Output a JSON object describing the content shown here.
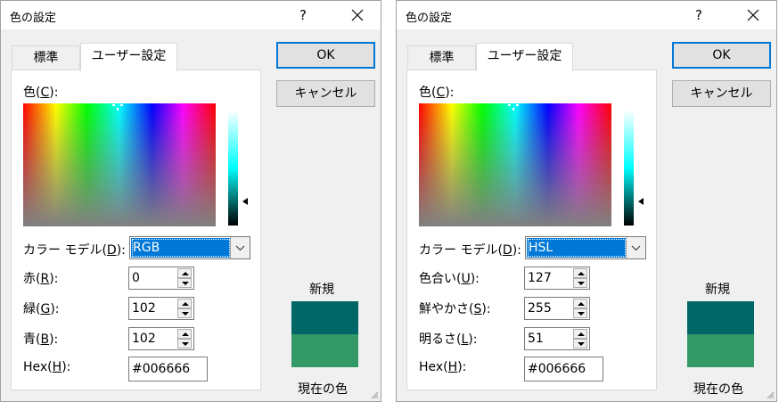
{
  "dialogs": [
    {
      "title": "色の設定",
      "help": "?",
      "tabs": [
        "標準",
        "ユーザー設定"
      ],
      "color_label_prefix": "色(",
      "color_label_key": "C",
      "color_label_suffix": "):",
      "model_label_prefix": "カラー モデル(",
      "model_label_key": "D",
      "model_label_suffix": "):",
      "model_value": "RGB",
      "fields": [
        {
          "prefix": "赤(",
          "key": "R",
          "suffix": "):",
          "value": "0"
        },
        {
          "prefix": "緑(",
          "key": "G",
          "suffix": "):",
          "value": "102"
        },
        {
          "prefix": "青(",
          "key": "B",
          "suffix": "):",
          "value": "102"
        }
      ],
      "hex_prefix": "Hex(",
      "hex_key": "H",
      "hex_suffix": "):",
      "hex_value": "#006666",
      "ok_label": "OK",
      "cancel_label": "キャンセル",
      "new_label": "新規",
      "current_label": "現在の色"
    },
    {
      "title": "色の設定",
      "help": "?",
      "tabs": [
        "標準",
        "ユーザー設定"
      ],
      "color_label_prefix": "色(",
      "color_label_key": "C",
      "color_label_suffix": "):",
      "model_label_prefix": "カラー モデル(",
      "model_label_key": "D",
      "model_label_suffix": "):",
      "model_value": "HSL",
      "fields": [
        {
          "prefix": "色合い(",
          "key": "U",
          "suffix": "):",
          "value": "127"
        },
        {
          "prefix": "鮮やかさ(",
          "key": "S",
          "suffix": "):",
          "value": "255"
        },
        {
          "prefix": "明るさ(",
          "key": "L",
          "suffix": "):",
          "value": "51"
        }
      ],
      "hex_prefix": "Hex(",
      "hex_key": "H",
      "hex_suffix": "):",
      "hex_value": "#006666",
      "ok_label": "OK",
      "cancel_label": "キャンセル",
      "new_label": "新規",
      "current_label": "現在の色"
    }
  ],
  "colors": {
    "new_color": "#006666",
    "current_color": "#339966",
    "accent": "#0078d7"
  },
  "icons": {
    "close": "close-icon",
    "dropdown": "chevron-down-icon",
    "spin_up": "arrow-up-icon",
    "spin_down": "arrow-down-icon",
    "luminance_pointer": "triangle-left-icon",
    "crosshair": "crosshair-icon",
    "resize": "resize-grip-icon"
  }
}
